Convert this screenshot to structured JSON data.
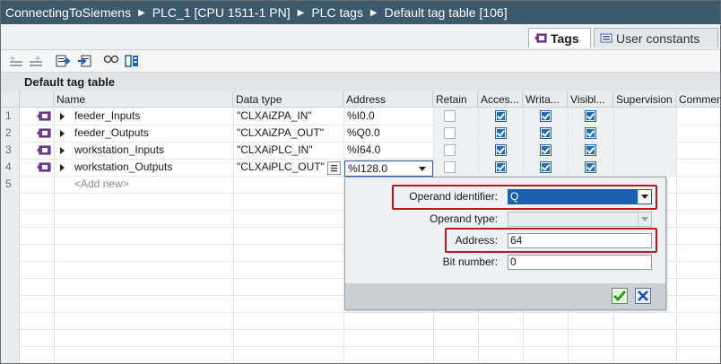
{
  "breadcrumb": [
    "ConnectingToSiemens",
    "PLC_1 [CPU 1511-1 PN]",
    "PLC tags",
    "Default tag table [106]"
  ],
  "tabs": {
    "tags": "Tags",
    "user_constants": "User constants"
  },
  "toolbar": {
    "icons": [
      "insert-row-icon",
      "add-row-icon",
      "export-icon",
      "import-icon",
      "monitor-icon",
      "display-options-icon"
    ]
  },
  "table": {
    "title": "Default tag table",
    "columns": [
      "Name",
      "Data type",
      "Address",
      "Retain",
      "Acces...",
      "Writa...",
      "Visibl...",
      "Supervision",
      "Commen"
    ],
    "rows": [
      {
        "num": "1",
        "name": "feeder_Inputs",
        "datatype": "\"CLXAiZPA_IN\"",
        "address": "%I0.0",
        "retain": false,
        "accessible": true,
        "writable": true,
        "visible": true
      },
      {
        "num": "2",
        "name": "feeder_Outputs",
        "datatype": "\"CLXAiZPA_OUT\"",
        "address": "%Q0.0",
        "retain": false,
        "accessible": true,
        "writable": true,
        "visible": true
      },
      {
        "num": "3",
        "name": "workstation_Inputs",
        "datatype": "\"CLXAiPLC_IN\"",
        "address": "%I64.0",
        "retain": false,
        "accessible": true,
        "writable": true,
        "visible": true
      },
      {
        "num": "4",
        "name": "workstation_Outputs",
        "datatype": "\"CLXAiPLC_OUT\"",
        "address": "%I128.0",
        "retain": false,
        "accessible": true,
        "writable": true,
        "visible": true
      }
    ],
    "add_row": {
      "num": "5",
      "placeholder": "<Add new>"
    }
  },
  "popup": {
    "operand_identifier_label": "Operand identifier:",
    "operand_identifier_value": "Q",
    "operand_type_label": "Operand type:",
    "operand_type_value": "",
    "address_label": "Address:",
    "address_value": "64",
    "bit_number_label": "Bit number:",
    "bit_number_value": "0"
  },
  "colors": {
    "crumb_bar": "#3c5a6b",
    "highlight": "#c0141e",
    "selection": "#1c5fad",
    "checkbox": "#1f6fb8"
  }
}
